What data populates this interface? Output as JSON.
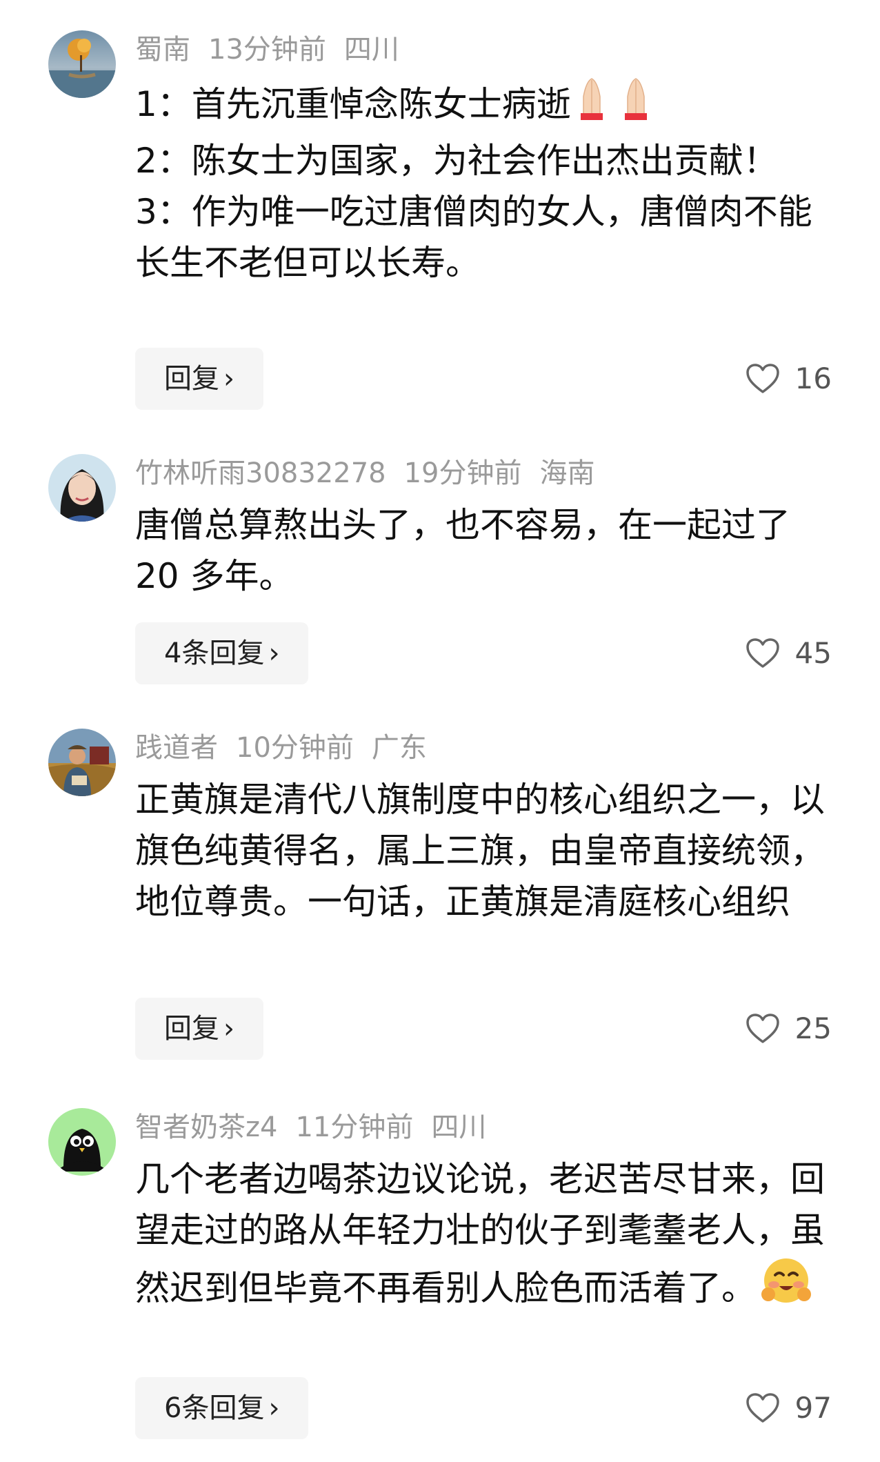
{
  "comments": [
    {
      "user": "蜀南",
      "time": "13分钟前",
      "region": "四川",
      "lines": [
        "1：首先沉重悼念陈女士病逝",
        "2：陈女士为国家，为社会作出杰出贡献！",
        "3：作为唯一吃过唐僧肉的女人，唐僧肉不能长生不老但可以长寿。"
      ],
      "reply_label": "回复",
      "likes": "16",
      "avatar_icon": "landscape-avatar"
    },
    {
      "user": "竹林听雨30832278",
      "time": "19分钟前",
      "region": "海南",
      "lines": [
        "唐僧总算熬出头了，也不容易，在一起过了 20 多年。"
      ],
      "reply_label": "4条回复",
      "likes": "45",
      "avatar_icon": "woman-portrait-avatar"
    },
    {
      "user": "践道者",
      "time": "10分钟前",
      "region": "广东",
      "lines": [
        "正黄旗是清代八旗制度中的核心组织之一，以旗色纯黄得名，属上三旗，由皇帝直接统领，地位尊贵。一句话，正黄旗是清庭核心组织"
      ],
      "reply_label": "回复",
      "likes": "25",
      "avatar_icon": "farmer-avatar"
    },
    {
      "user": "智者奶茶z4",
      "time": "11分钟前",
      "region": "四川",
      "lines": [
        "几个老者边喝茶边议论说，老迟苦尽甘来，回望走过的路从年轻力壮的伙子到耄耋老人，虽然迟到但毕竟不再看别人脸色而活着了。"
      ],
      "reply_label": "6条回复",
      "likes": "97",
      "avatar_icon": "bird-avatar"
    }
  ],
  "colors": {
    "meta": "#9a9a9a",
    "text": "#111111",
    "button_bg": "#f5f5f5"
  }
}
